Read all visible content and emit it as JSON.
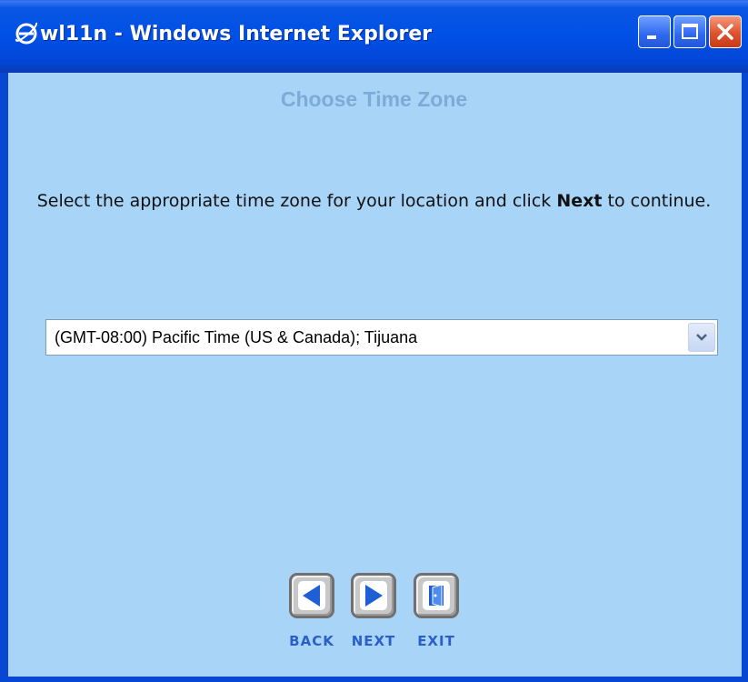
{
  "window": {
    "title": "wl11n - Windows Internet Explorer"
  },
  "page": {
    "heading": "Choose Time Zone",
    "instruction_before": "Select the appropriate time zone for your location and click ",
    "instruction_bold": "Next",
    "instruction_after": " to continue."
  },
  "timezone_select": {
    "selected": "(GMT-08:00) Pacific Time (US & Canada); Tijuana"
  },
  "nav": {
    "back_label": "BACK",
    "next_label": "NEXT",
    "exit_label": "EXIT"
  },
  "colors": {
    "content_background": "#a8d4f8",
    "heading": "#7cabd8",
    "titlebar": "#0050e6",
    "nav_label": "#2b5fc7",
    "nav_icon": "#1f5fd6"
  }
}
